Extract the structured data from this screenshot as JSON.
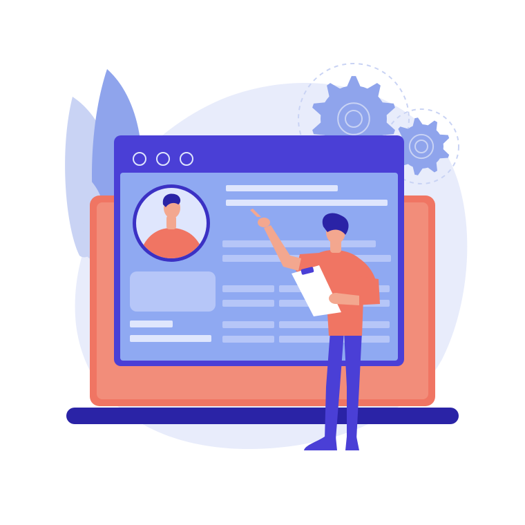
{
  "illustration": {
    "colors": {
      "background_blob": "#e8ecfb",
      "leaf_light": "#c9d3f4",
      "leaf_mid": "#8fa4ec",
      "gear": "#8fa4ec",
      "gear_outline": "#c9d3f4",
      "laptop_body": "#f07563",
      "laptop_bezel": "#f28d7a",
      "laptop_base": "#2a23a6",
      "window_frame": "#4a3fd6",
      "window_content": "#8fa9f2",
      "content_line": "#dfe6fd",
      "content_block": "#b6c6f8",
      "avatar_ring": "#3b31c4",
      "avatar_bg": "#dfe6fd",
      "shirt": "#f07563",
      "skin": "#f3a78f",
      "hair": "#2a23a6",
      "pants": "#4a3fd6",
      "shoes": "#4a3fd6",
      "clipboard": "#ffffff"
    },
    "icons": {
      "window_controls": "three-circle-buttons",
      "gears": "settings-gears",
      "avatar": "user-profile-avatar"
    }
  }
}
